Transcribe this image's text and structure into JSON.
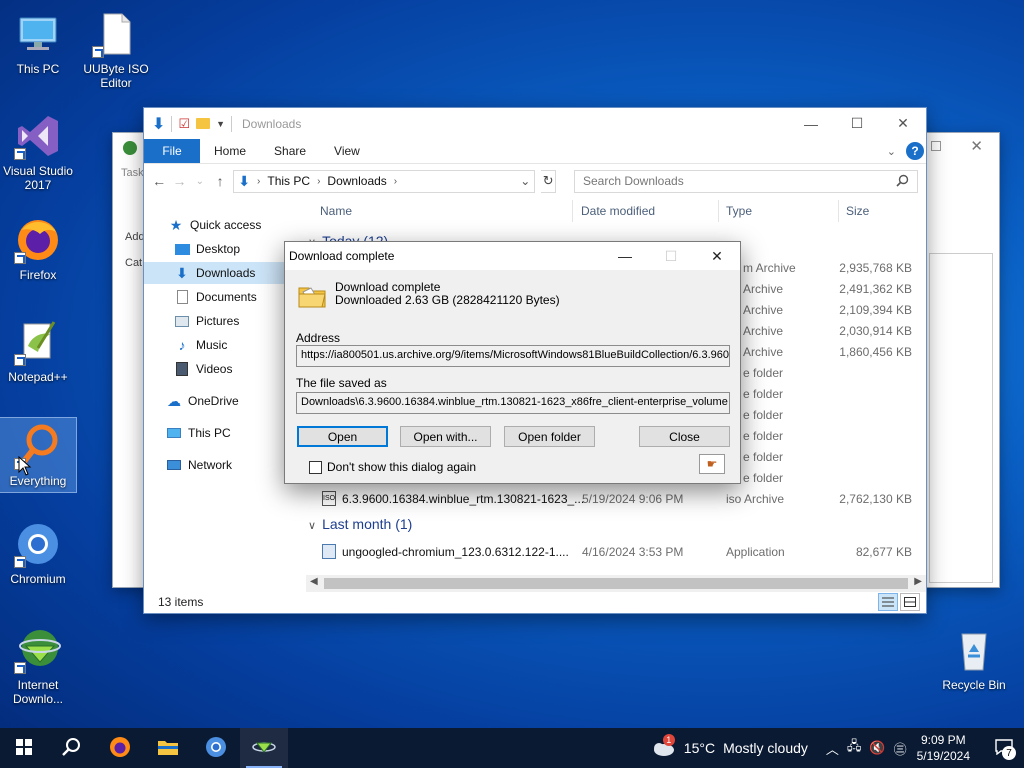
{
  "desktop": {
    "icons": [
      {
        "label": "This PC"
      },
      {
        "label": "UUByte ISO Editor"
      },
      {
        "label": "Visual Studio 2017"
      },
      {
        "label": "Firefox"
      },
      {
        "label": "Notepad++"
      },
      {
        "label": "Everything"
      },
      {
        "label": "Chromium"
      },
      {
        "label": "Internet Downlo..."
      },
      {
        "label": "Recycle Bin"
      }
    ]
  },
  "bg_window": {
    "partial_labels": {
      "task": "Task",
      "add": "Add",
      "cat": "Cat"
    }
  },
  "explorer": {
    "title": "Downloads",
    "tabs": {
      "file": "File",
      "home": "Home",
      "share": "Share",
      "view": "View"
    },
    "breadcrumb": {
      "root": "This PC",
      "current": "Downloads"
    },
    "search_placeholder": "Search Downloads",
    "nav": {
      "quick_access": "Quick access",
      "desktop": "Desktop",
      "downloads": "Downloads",
      "documents": "Documents",
      "pictures": "Pictures",
      "music": "Music",
      "videos": "Videos",
      "onedrive": "OneDrive",
      "this_pc": "This PC",
      "network": "Network"
    },
    "columns": {
      "name": "Name",
      "date": "Date modified",
      "type": "Type",
      "size": "Size"
    },
    "groups": {
      "today": "Today (12)",
      "last_month": "Last month (1)"
    },
    "partial_rows": [
      {
        "type": "m Archive",
        "size": "2,935,768 KB"
      },
      {
        "type": "Archive",
        "size": "2,491,362 KB"
      },
      {
        "type": "Archive",
        "size": "2,109,394 KB"
      },
      {
        "type": "Archive",
        "size": "2,030,914 KB"
      },
      {
        "type": "Archive",
        "size": "1,860,456 KB"
      },
      {
        "type": "e folder"
      },
      {
        "type": "e folder"
      },
      {
        "type": "e folder"
      },
      {
        "type": "e folder"
      },
      {
        "type": "e folder"
      },
      {
        "type": "e folder"
      }
    ],
    "rows": [
      {
        "name": "6.3.9600.16384.winblue_rtm.130821-1623_...",
        "date": "5/19/2024 9:06 PM",
        "type": "iso Archive",
        "size": "2,762,130 KB"
      },
      {
        "name": "ungoogled-chromium_123.0.6312.122-1....",
        "date": "4/16/2024 3:53 PM",
        "type": "Application",
        "size": "82,677 KB"
      }
    ],
    "status": "13 items"
  },
  "dialog": {
    "title": "Download complete",
    "heading": "Download complete",
    "downloaded": "Downloaded 2.63  GB (2828421120 Bytes)",
    "address_label": "Address",
    "address_value": "https://ia800501.us.archive.org/9/items/MicrosoftWindows81BlueBuildCollection/6.3.960",
    "saved_label": "The file saved as",
    "saved_value": "Downloads\\6.3.9600.16384.winblue_rtm.130821-1623_x86fre_client-enterprise_volume",
    "buttons": {
      "open": "Open",
      "open_with": "Open with...",
      "open_folder": "Open folder",
      "close": "Close"
    },
    "checkbox": "Don't show this dialog again"
  },
  "taskbar": {
    "weather": {
      "temp": "15°C",
      "condition": "Mostly cloudy",
      "alert_count": "1"
    },
    "clock": {
      "time": "9:09 PM",
      "date": "5/19/2024"
    },
    "notification_count": "7"
  }
}
